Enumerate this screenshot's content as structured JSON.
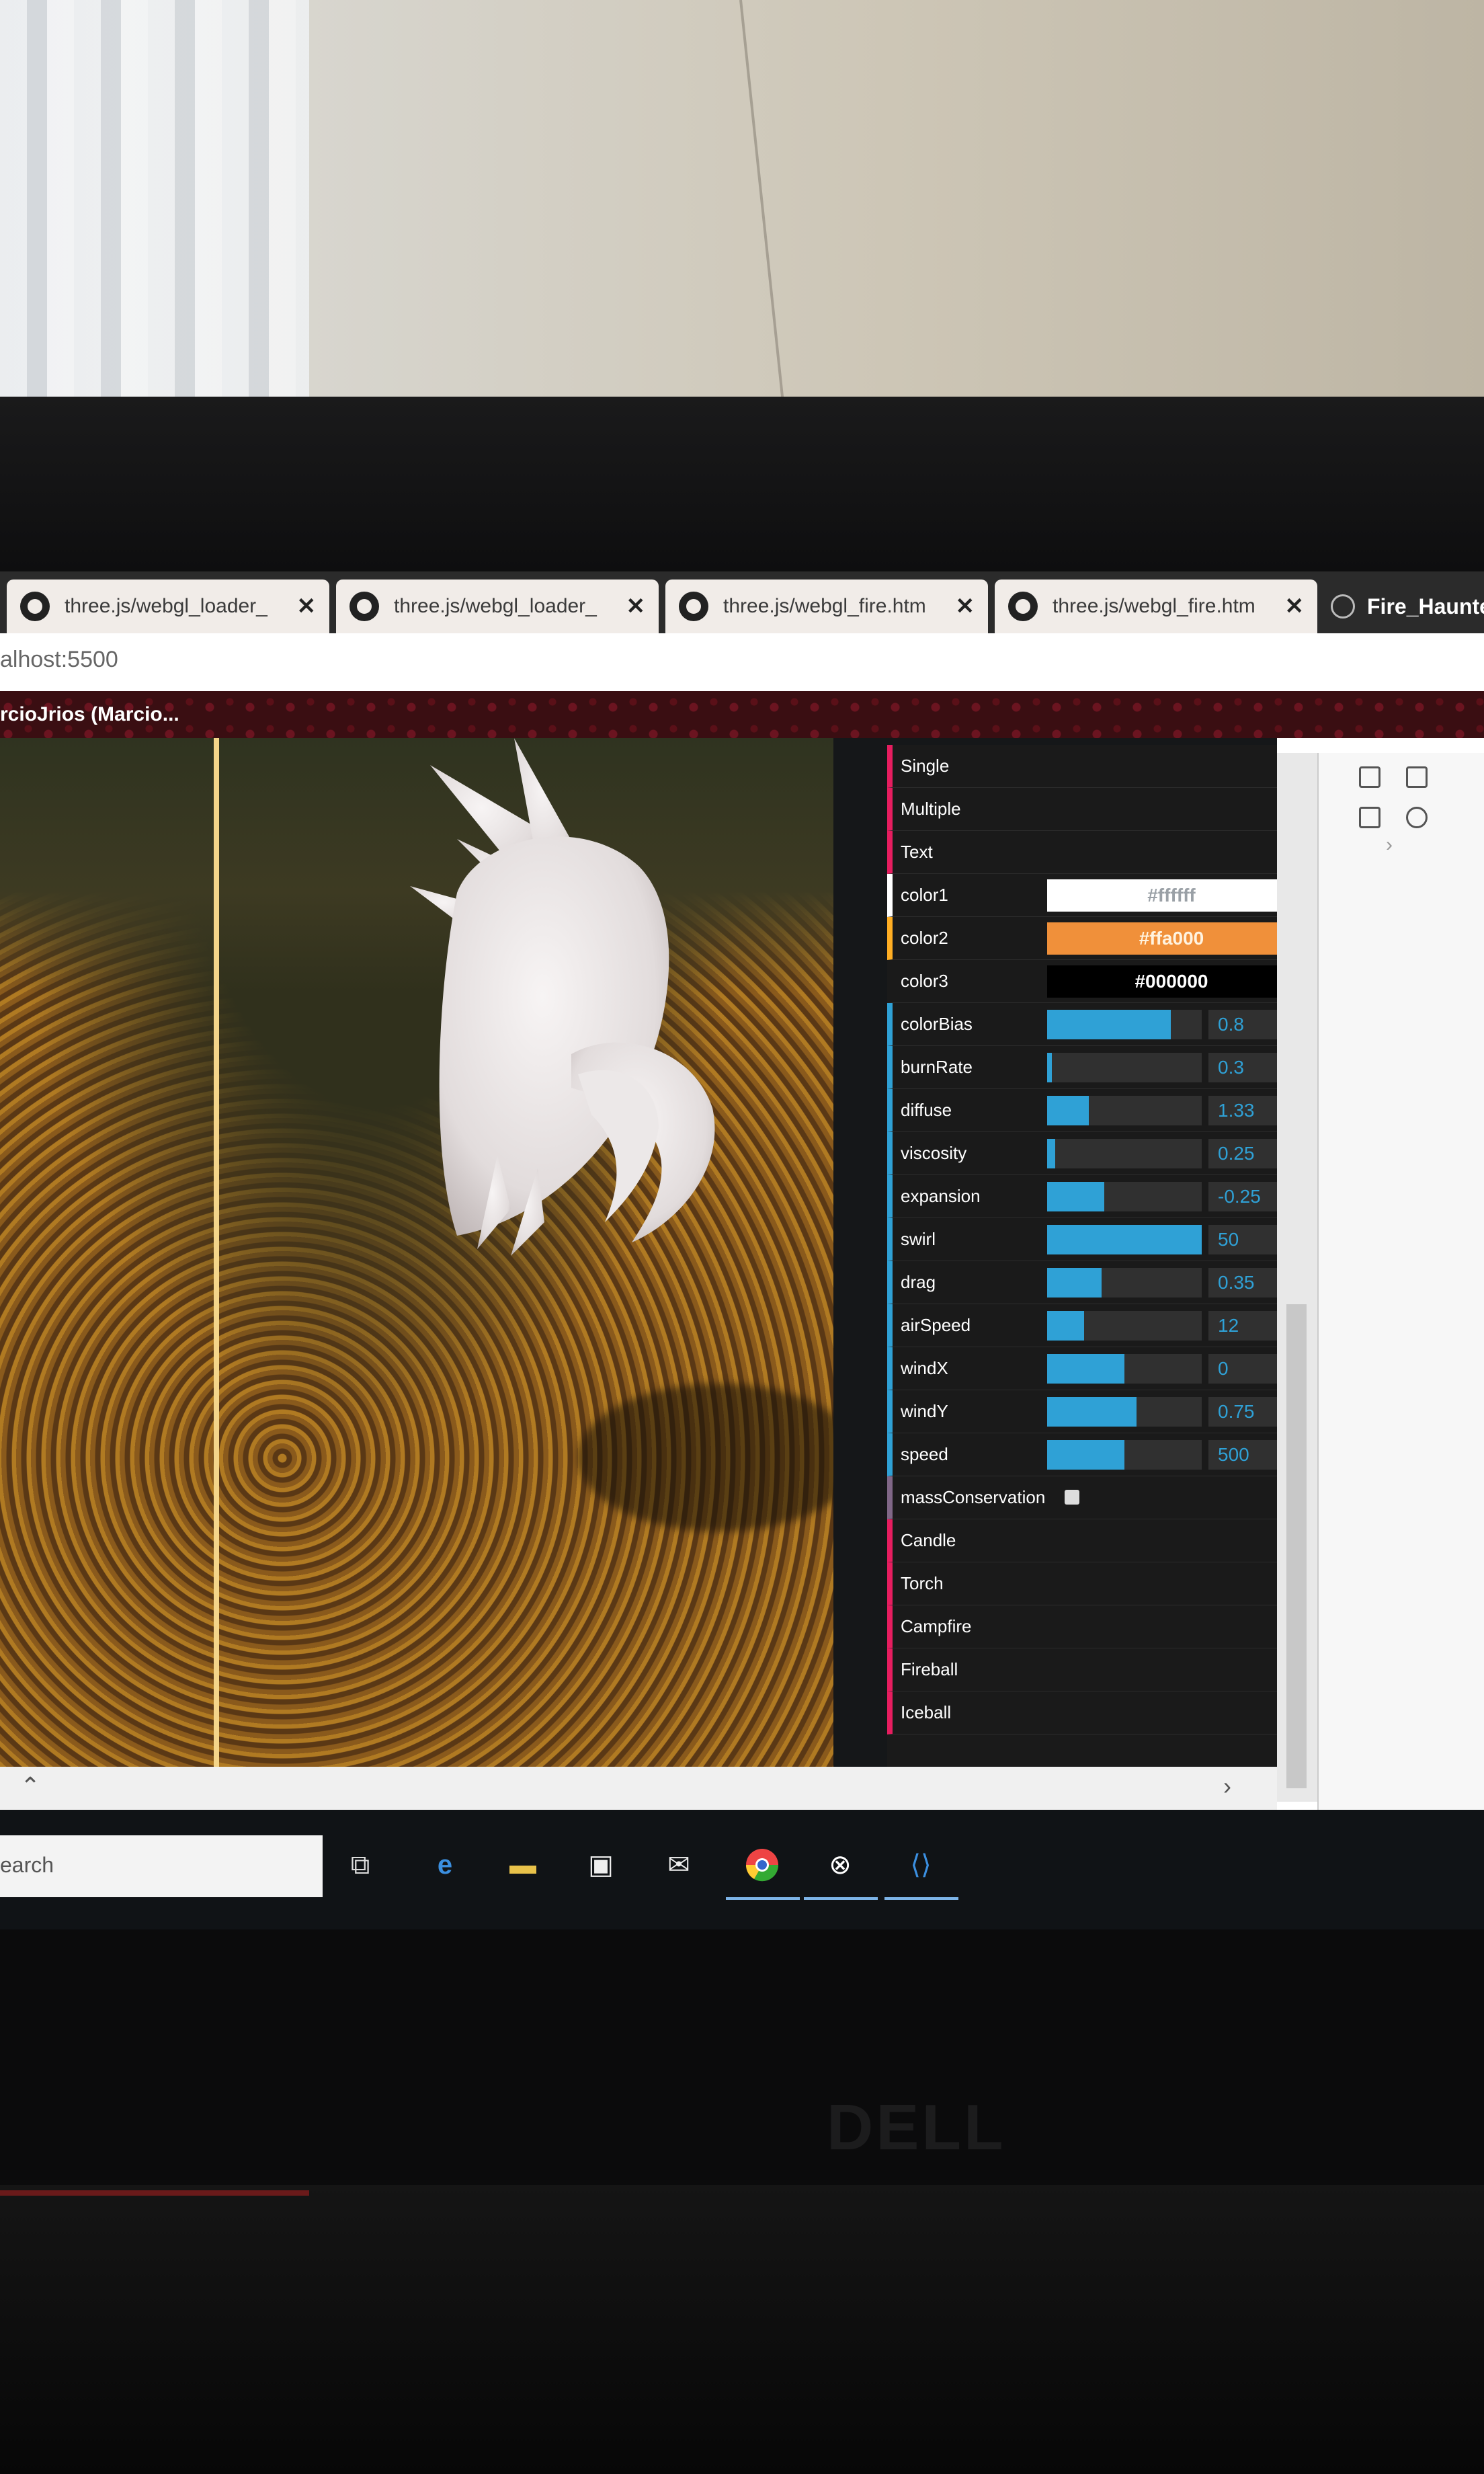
{
  "tabs": [
    {
      "title": "three.js/webgl_loader_",
      "close": "✕"
    },
    {
      "title": "three.js/webgl_loader_",
      "close": "✕"
    },
    {
      "title": "three.js/webgl_fire.htm",
      "close": "✕"
    },
    {
      "title": "three.js/webgl_fire.htm",
      "close": "✕"
    }
  ],
  "active_tab": {
    "title": "Fire_Haunte"
  },
  "address": {
    "url": "alhost:5500"
  },
  "bookmarks": {
    "label": "rcioJrios (Marcio..."
  },
  "gui": {
    "presets": [
      "Single",
      "Multiple",
      "Text"
    ],
    "colors": [
      {
        "label": "color1",
        "value": "#ffffff",
        "bg": "#ffffff",
        "fg": "#9aa0a6"
      },
      {
        "label": "color2",
        "value": "#ffa000",
        "bg": "#f0903a",
        "fg": "#fff3e0"
      },
      {
        "label": "color3",
        "value": "#000000",
        "bg": "#000000",
        "fg": "#ffffff"
      }
    ],
    "numbers": [
      {
        "label": "colorBias",
        "value": "0.8",
        "fill": 0.8
      },
      {
        "label": "burnRate",
        "value": "0.3",
        "fill": 0.03
      },
      {
        "label": "diffuse",
        "value": "1.33",
        "fill": 0.27
      },
      {
        "label": "viscosity",
        "value": "0.25",
        "fill": 0.05
      },
      {
        "label": "expansion",
        "value": "-0.25",
        "fill": 0.37
      },
      {
        "label": "swirl",
        "value": "50",
        "fill": 1.0
      },
      {
        "label": "drag",
        "value": "0.35",
        "fill": 0.35
      },
      {
        "label": "airSpeed",
        "value": "12",
        "fill": 0.24
      },
      {
        "label": "windX",
        "value": "0",
        "fill": 0.5
      },
      {
        "label": "windY",
        "value": "0.75",
        "fill": 0.58
      },
      {
        "label": "speed",
        "value": "500",
        "fill": 0.5
      }
    ],
    "checkbox": {
      "label": "massConservation",
      "checked": false
    },
    "fire_presets": [
      "Candle",
      "Torch",
      "Campfire",
      "Fireball",
      "Iceball"
    ]
  },
  "taskbar": {
    "search_placeholder": "earch"
  },
  "bezel": {
    "brand": "DELL"
  }
}
